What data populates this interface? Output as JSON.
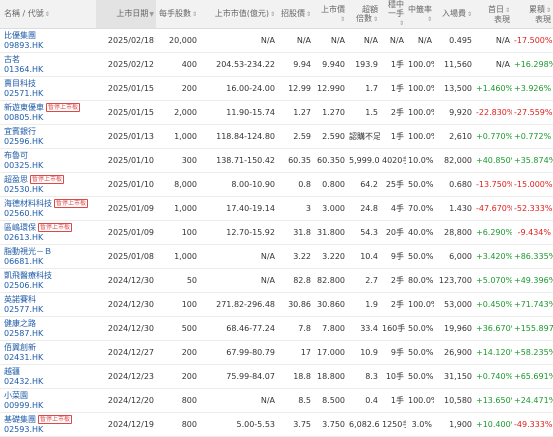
{
  "headers": {
    "name": "名稱 / 代號",
    "date": "上市日期",
    "lot": "每手股數",
    "mcap": "上市市值(億元)",
    "pe": "招股價",
    "listprice": "上市價",
    "oversub": [
      "超額",
      "倍數"
    ],
    "onelot": [
      "穩中",
      "一手"
    ],
    "winrate": "中籤率",
    "entry": "入場費",
    "firstday": [
      "首日",
      "表現"
    ],
    "cumulative": [
      "累積",
      "表現"
    ]
  },
  "rows": [
    {
      "name": "比優集團",
      "code": "09893.HK",
      "tag": "",
      "date": "2025/02/18",
      "lot": "20,000",
      "mcap": "N/A",
      "pe": "N/A",
      "listprice": "N/A",
      "oversub": "N/A",
      "onelot": "N/A",
      "winrate": "N/A",
      "entry": "0.495",
      "firstday": "N/A",
      "cumulative": "-17.500%",
      "fd": "neu",
      "cu": "down"
    },
    {
      "name": "古茗",
      "code": "01364.HK",
      "tag": "",
      "date": "2025/02/12",
      "lot": "400",
      "mcap": "204.53-234.22",
      "pe": "9.94",
      "listprice": "9.940",
      "oversub": "193.9",
      "onelot": "1手",
      "winrate": "100.0%",
      "entry": "11,560",
      "firstday": "N/A",
      "cumulative": "+16.298%",
      "fd": "neu",
      "cu": "up"
    },
    {
      "name": "賣目科技",
      "code": "02571.HK",
      "tag": "",
      "date": "2025/01/15",
      "lot": "200",
      "mcap": "16.00-24.00",
      "pe": "12.99",
      "listprice": "12.990",
      "oversub": "1.7",
      "onelot": "1手",
      "winrate": "100.0%",
      "entry": "13,500",
      "firstday": "+1.460%",
      "cumulative": "+3.926%",
      "fd": "up",
      "cu": "up"
    },
    {
      "name": "新遊東優車",
      "code": "00805.HK",
      "tag": "暫停上市板",
      "date": "2025/01/15",
      "lot": "2,000",
      "mcap": "11.90-15.74",
      "pe": "1.27",
      "listprice": "1.270",
      "oversub": "1.5",
      "onelot": "2手",
      "winrate": "100.0%",
      "entry": "9,920",
      "firstday": "-22.830%",
      "cumulative": "-27.559%",
      "fd": "down",
      "cu": "down"
    },
    {
      "name": "宜賓銀行",
      "code": "02596.HK",
      "tag": "",
      "date": "2025/01/13",
      "lot": "1,000",
      "mcap": "118.84-124.80",
      "pe": "2.59",
      "listprice": "2.590",
      "oversub": "認購不足",
      "onelot": "1手",
      "winrate": "100.0%",
      "entry": "2,610",
      "firstday": "+0.770%",
      "cumulative": "+0.772%",
      "fd": "up",
      "cu": "up"
    },
    {
      "name": "布魯可",
      "code": "00325.HK",
      "tag": "",
      "date": "2025/01/10",
      "lot": "300",
      "mcap": "138.71-150.42",
      "pe": "60.35",
      "listprice": "60.350",
      "oversub": "5,999.0",
      "onelot": "4020手",
      "winrate": "10.0%",
      "entry": "82,000",
      "firstday": "+40.850%",
      "cumulative": "+35.874%",
      "fd": "up",
      "cu": "up"
    },
    {
      "name": "超盈思",
      "code": "02530.HK",
      "tag": "暫停上市板",
      "date": "2025/01/10",
      "lot": "8,000",
      "mcap": "8.00-10.90",
      "pe": "0.8",
      "listprice": "0.800",
      "oversub": "64.2",
      "onelot": "25手",
      "winrate": "50.0%",
      "entry": "0.680",
      "firstday": "-13.750%",
      "cumulative": "-15.000%",
      "fd": "down",
      "cu": "down"
    },
    {
      "name": "海德材料科技",
      "code": "02560.HK",
      "tag": "暫停上市板",
      "date": "2025/01/09",
      "lot": "1,000",
      "mcap": "17.40-19.14",
      "pe": "3",
      "listprice": "3.000",
      "oversub": "24.8",
      "onelot": "4手",
      "winrate": "70.0%",
      "entry": "1.430",
      "firstday": "-47.670%",
      "cumulative": "-52.333%",
      "fd": "down",
      "cu": "down"
    },
    {
      "name": "區嶋環保",
      "code": "02613.HK",
      "tag": "暫停上市板",
      "date": "2025/01/09",
      "lot": "100",
      "mcap": "12.70-15.92",
      "pe": "31.8",
      "listprice": "31.800",
      "oversub": "54.3",
      "onelot": "20手",
      "winrate": "40.0%",
      "entry": "28,800",
      "firstday": "+6.290%",
      "cumulative": "-9.434%",
      "fd": "up",
      "cu": "down"
    },
    {
      "name": "脂動視光－Ｂ",
      "code": "06681.HK",
      "tag": "",
      "date": "2025/01/08",
      "lot": "1,000",
      "mcap": "N/A",
      "pe": "3.22",
      "listprice": "3.220",
      "oversub": "10.4",
      "onelot": "9手",
      "winrate": "50.0%",
      "entry": "6,000",
      "firstday": "+3.420%",
      "cumulative": "+86.335%",
      "fd": "up",
      "cu": "up"
    },
    {
      "name": "凱飛醫療科技",
      "code": "02506.HK",
      "tag": "",
      "date": "2024/12/30",
      "lot": "50",
      "mcap": "N/A",
      "pe": "82.8",
      "listprice": "82.800",
      "oversub": "2.7",
      "onelot": "2手",
      "winrate": "80.0%",
      "entry": "123,700",
      "firstday": "+5.070%",
      "cumulative": "+49.396%",
      "fd": "up",
      "cu": "up"
    },
    {
      "name": "英諾賽科",
      "code": "02577.HK",
      "tag": "",
      "date": "2024/12/30",
      "lot": "100",
      "mcap": "271.82-296.48",
      "pe": "30.86",
      "listprice": "30.860",
      "oversub": "1.9",
      "onelot": "2手",
      "winrate": "100.0%",
      "entry": "53,000",
      "firstday": "+0.450%",
      "cumulative": "+71.743%",
      "fd": "up",
      "cu": "up"
    },
    {
      "name": "健康之路",
      "code": "02587.HK",
      "tag": "",
      "date": "2024/12/30",
      "lot": "500",
      "mcap": "68.46-77.24",
      "pe": "7.8",
      "listprice": "7.800",
      "oversub": "33.4",
      "onelot": "160手",
      "winrate": "50.0%",
      "entry": "19,960",
      "firstday": "+36.670%",
      "cumulative": "+155.897%",
      "fd": "up",
      "cu": "up"
    },
    {
      "name": "佰翼創新",
      "code": "02431.HK",
      "tag": "",
      "date": "2024/12/27",
      "lot": "200",
      "mcap": "67.99-80.79",
      "pe": "17",
      "listprice": "17.000",
      "oversub": "10.9",
      "onelot": "9手",
      "winrate": "50.0%",
      "entry": "26,900",
      "firstday": "+14.120%",
      "cumulative": "+58.235%",
      "fd": "up",
      "cu": "up"
    },
    {
      "name": "越疆",
      "code": "02432.HK",
      "tag": "",
      "date": "2024/12/23",
      "lot": "200",
      "mcap": "75.99-84.07",
      "pe": "18.8",
      "listprice": "18.800",
      "oversub": "8.3",
      "onelot": "10手",
      "winrate": "50.0%",
      "entry": "31,150",
      "firstday": "+0.740%",
      "cumulative": "+65.691%",
      "fd": "up",
      "cu": "up"
    },
    {
      "name": "小菜園",
      "code": "00999.HK",
      "tag": "",
      "date": "2024/12/20",
      "lot": "800",
      "mcap": "N/A",
      "pe": "8.5",
      "listprice": "8.500",
      "oversub": "0.4",
      "onelot": "1手",
      "winrate": "100.0%",
      "entry": "10,580",
      "firstday": "+13.650%",
      "cumulative": "+24.471%",
      "fd": "up",
      "cu": "up"
    },
    {
      "name": "基礎集團",
      "code": "02593.HK",
      "tag": "暫停上市板",
      "date": "2024/12/19",
      "lot": "800",
      "mcap": "5.00-5.53",
      "pe": "3.75",
      "listprice": "3.750",
      "oversub": "6,082.6",
      "onelot": "1250手",
      "winrate": "3.0%",
      "entry": "1,900",
      "firstday": "+10.400%",
      "cumulative": "-49.333%",
      "fd": "up",
      "cu": "down"
    }
  ]
}
